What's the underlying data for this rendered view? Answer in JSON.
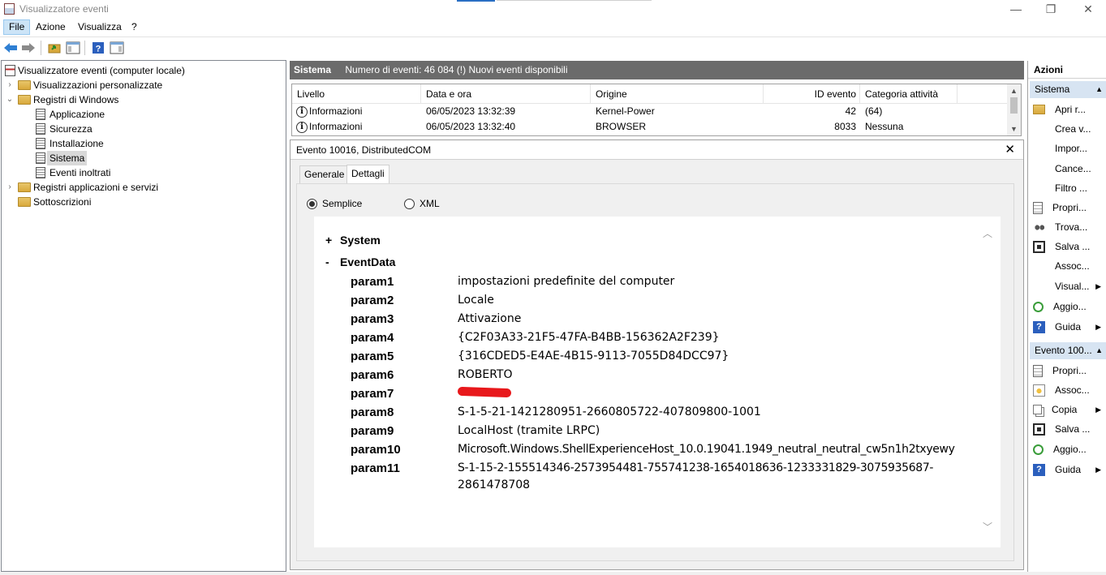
{
  "window": {
    "title": "Visualizzatore eventi",
    "minimize_glyph": "—",
    "maximize_glyph": "❐",
    "close_glyph": "✕"
  },
  "menu": {
    "items": [
      "File",
      "Azione",
      "Visualizza",
      "?"
    ]
  },
  "tree": {
    "root": "Visualizzatore eventi (computer locale)",
    "items": [
      {
        "label": "Visualizzazioni personalizzate",
        "expander": "›",
        "icon": "folder-icon"
      },
      {
        "label": "Registri di Windows",
        "expander": "⌄",
        "icon": "folder-icon"
      },
      {
        "label": "Applicazione",
        "icon": "log-icon"
      },
      {
        "label": "Sicurezza",
        "icon": "log-icon"
      },
      {
        "label": "Installazione",
        "icon": "log-icon"
      },
      {
        "label": "Sistema",
        "icon": "log-icon",
        "selected": true
      },
      {
        "label": "Eventi inoltrati",
        "icon": "log-icon"
      },
      {
        "label": "Registri applicazioni e servizi",
        "expander": "›",
        "icon": "folder-icon"
      },
      {
        "label": "Sottoscrizioni",
        "icon": "folder-icon"
      }
    ]
  },
  "log_header": {
    "name": "Sistema",
    "info": "Numero di eventi: 46 084 (!) Nuovi eventi disponibili"
  },
  "event_list": {
    "columns": [
      "Livello",
      "Data e ora",
      "Origine",
      "ID evento",
      "Categoria attività"
    ],
    "rows": [
      {
        "level": "Informazioni",
        "datetime": "06/05/2023 13:32:39",
        "source": "Kernel-Power",
        "id": "42",
        "category": "(64)"
      },
      {
        "level": "Informazioni",
        "datetime": "06/05/2023 13:32:40",
        "source": "BROWSER",
        "id": "8033",
        "category": "Nessuna"
      }
    ]
  },
  "detail": {
    "title": "Evento 10016, DistributedCOM",
    "close_glyph": "✕",
    "tabs": [
      "Generale",
      "Dettagli"
    ],
    "active_tab": "Dettagli",
    "radio": {
      "simple": "Semplice",
      "xml": "XML",
      "selected": "Semplice"
    },
    "system": {
      "sign": "+",
      "label": "System"
    },
    "eventdata": {
      "sign": "-",
      "label": "EventData"
    },
    "params": [
      {
        "key": "param1",
        "value": "impostazioni predefinite del computer"
      },
      {
        "key": "param2",
        "value": "Locale"
      },
      {
        "key": "param3",
        "value": "Attivazione"
      },
      {
        "key": "param4",
        "value": "{C2F03A33-21F5-47FA-B4BB-156362A2F239}"
      },
      {
        "key": "param5",
        "value": "{316CDED5-E4AE-4B15-9113-7055D84DCC97}"
      },
      {
        "key": "param6",
        "value": "ROBERTO"
      },
      {
        "key": "param7",
        "value": "",
        "redacted": true
      },
      {
        "key": "param8",
        "value": "S-1-5-21-1421280951-2660805722-407809800-1001"
      },
      {
        "key": "param9",
        "value": "LocalHost (tramite LRPC)"
      },
      {
        "key": "param10",
        "value": "Microsoft.Windows.ShellExperienceHost_10.0.19041.1949_neutral_neutral_cw5n1h2txyewy"
      },
      {
        "key": "param11",
        "value": "S-1-15-2-155514346-2573954481-755741238-1654018636-1233331829-3075935687-",
        "value_cont": "2861478708"
      }
    ]
  },
  "actions": {
    "title": "Azioni",
    "section1": "Sistema",
    "section1_items": [
      {
        "label": "Apri r...",
        "icon": "open-icon"
      },
      {
        "label": "Crea v...",
        "icon": "filter-icon"
      },
      {
        "label": "Impor...",
        "icon": "blank"
      },
      {
        "label": "Cance...",
        "icon": "blank"
      },
      {
        "label": "Filtro ...",
        "icon": "filter-icon"
      },
      {
        "label": "Propri...",
        "icon": "properties-icon"
      },
      {
        "label": "Trova...",
        "icon": "find-icon"
      },
      {
        "label": "Salva ...",
        "icon": "save-icon"
      },
      {
        "label": "Assoc...",
        "icon": "blank"
      },
      {
        "label": "Visual...",
        "icon": "blank",
        "submenu": true
      },
      {
        "label": "Aggio...",
        "icon": "refresh-icon"
      },
      {
        "label": "Guida",
        "icon": "help-icon",
        "submenu": true
      }
    ],
    "section2": "Evento 100...",
    "section2_items": [
      {
        "label": "Propri...",
        "icon": "properties-icon"
      },
      {
        "label": "Assoc...",
        "icon": "assoc-icon"
      },
      {
        "label": "Copia",
        "icon": "copy-icon",
        "submenu": true
      },
      {
        "label": "Salva ...",
        "icon": "save-icon"
      },
      {
        "label": "Aggio...",
        "icon": "refresh-icon"
      },
      {
        "label": "Guida",
        "icon": "help-icon",
        "submenu": true
      }
    ],
    "collapse_glyph": "▲",
    "submenu_glyph": "▶"
  }
}
